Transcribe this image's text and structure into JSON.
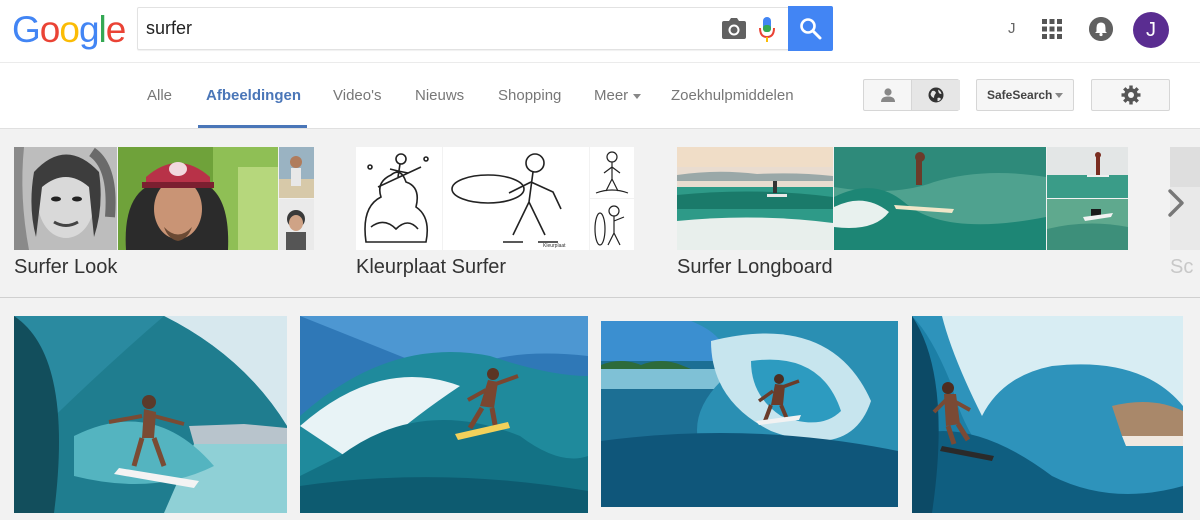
{
  "header": {
    "logo_letters": [
      {
        "char": "G",
        "color": "#4285f4"
      },
      {
        "char": "o",
        "color": "#ea4335"
      },
      {
        "char": "o",
        "color": "#fbbc05"
      },
      {
        "char": "g",
        "color": "#4285f4"
      },
      {
        "char": "l",
        "color": "#34a853"
      },
      {
        "char": "e",
        "color": "#ea4335"
      }
    ],
    "search_value": "surfer",
    "account_initial": "J",
    "avatar_letter": "J",
    "icons": [
      "camera-icon",
      "microphone-icon",
      "search-icon",
      "apps-grid-icon",
      "notifications-bell-icon"
    ]
  },
  "nav": {
    "tabs": [
      {
        "label": "Alle",
        "active": false
      },
      {
        "label": "Afbeeldingen",
        "active": true
      },
      {
        "label": "Video's",
        "active": false
      },
      {
        "label": "Nieuws",
        "active": false
      },
      {
        "label": "Shopping",
        "active": false
      },
      {
        "label": "Meer",
        "active": false,
        "dropdown": true
      },
      {
        "label": "Zoekhulpmiddelen",
        "active": false
      }
    ],
    "safesearch_label": "SafeSearch",
    "accent_color": "#4a76b8"
  },
  "related_searches": [
    {
      "label": "Surfer Look"
    },
    {
      "label": "Kleurplaat Surfer"
    },
    {
      "label": "Surfer Longboard"
    },
    {
      "label": "Sc",
      "truncated": true
    }
  ],
  "results": [
    {
      "alt": "surfer in barrel wave 1"
    },
    {
      "alt": "surfer in barrel wave 2"
    },
    {
      "alt": "surfer in barrel wave 3"
    },
    {
      "alt": "surfer in barrel wave 4"
    }
  ]
}
